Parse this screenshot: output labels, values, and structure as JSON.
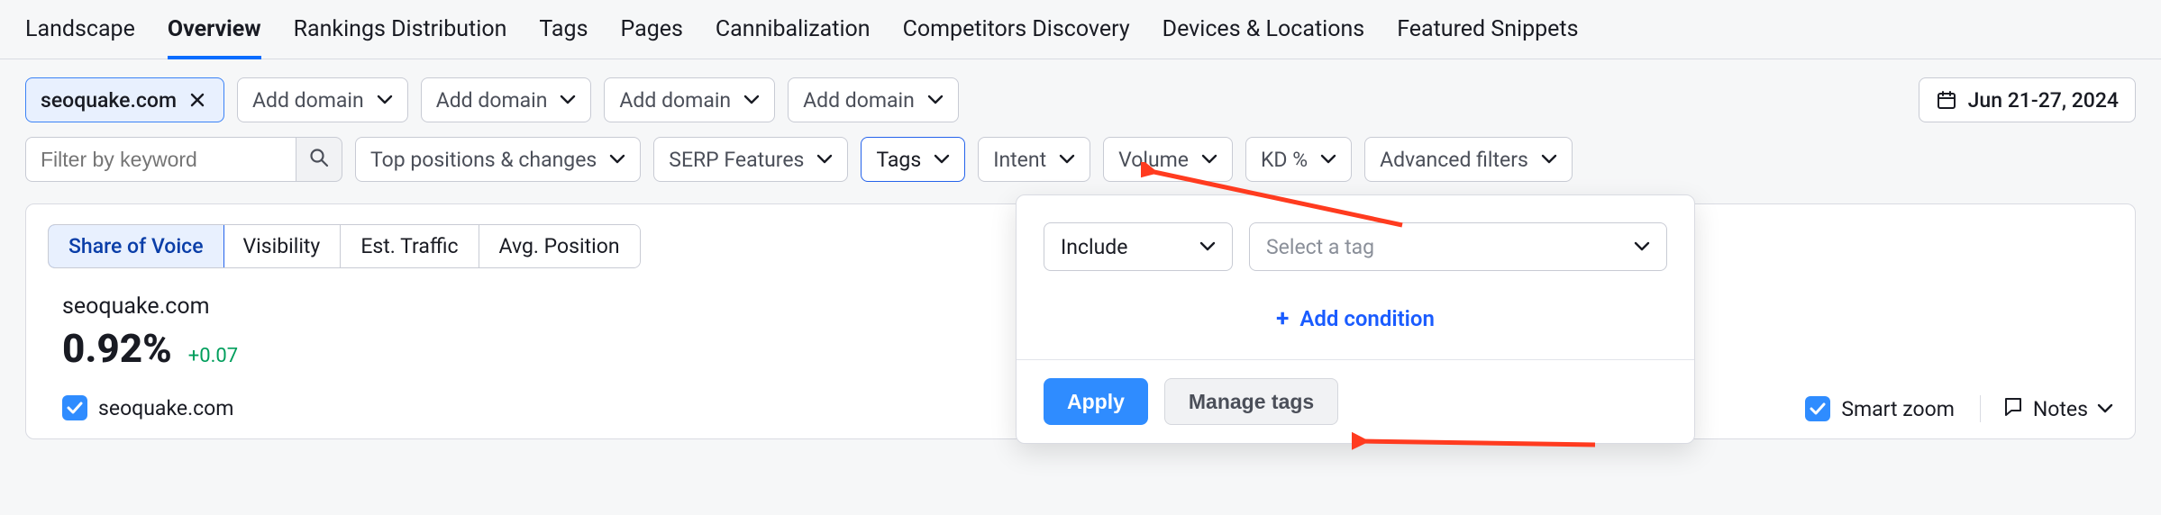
{
  "tabs": {
    "items": [
      {
        "label": "Landscape"
      },
      {
        "label": "Overview"
      },
      {
        "label": "Rankings Distribution"
      },
      {
        "label": "Tags"
      },
      {
        "label": "Pages"
      },
      {
        "label": "Cannibalization"
      },
      {
        "label": "Competitors Discovery"
      },
      {
        "label": "Devices & Locations"
      },
      {
        "label": "Featured Snippets"
      }
    ],
    "active_index": 1
  },
  "domains": {
    "primary": "seoquake.com",
    "add_label": "Add domain"
  },
  "date_range": "Jun 21-27, 2024",
  "filters": {
    "keyword_placeholder": "Filter by keyword",
    "top_positions": "Top positions & changes",
    "serp_features": "SERP Features",
    "tags": "Tags",
    "intent": "Intent",
    "volume": "Volume",
    "kd": "KD %",
    "advanced": "Advanced filters"
  },
  "metrics": {
    "tabs": [
      {
        "label": "Share of Voice"
      },
      {
        "label": "Visibility"
      },
      {
        "label": "Est. Traffic"
      },
      {
        "label": "Avg. Position"
      }
    ],
    "active_index": 0,
    "domain": "seoquake.com",
    "value": "0.92%",
    "delta": "+0.07",
    "legend_domain": "seoquake.com"
  },
  "footer": {
    "smart_zoom": "Smart zoom",
    "notes": "Notes"
  },
  "tags_dropdown": {
    "mode": "Include",
    "select_placeholder": "Select a tag",
    "add_condition": "Add condition",
    "apply": "Apply",
    "manage": "Manage tags"
  }
}
